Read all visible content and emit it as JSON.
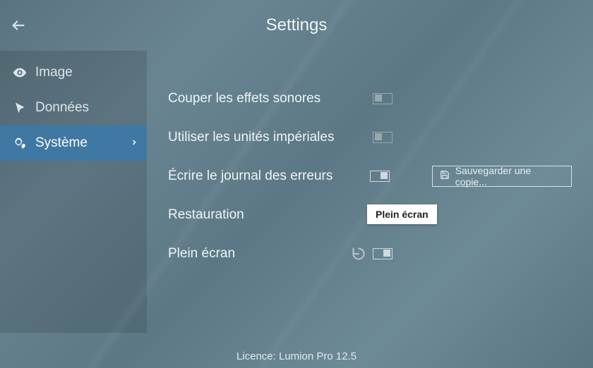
{
  "header": {
    "title": "Settings"
  },
  "sidebar": {
    "items": [
      {
        "label": "Image"
      },
      {
        "label": "Données"
      },
      {
        "label": "Système"
      }
    ]
  },
  "settings": {
    "mute_sound": {
      "label": "Couper les effets sonores",
      "on": false
    },
    "imperial": {
      "label": "Utiliser les unités impériales",
      "on": false
    },
    "error_log": {
      "label": "Écrire le journal des erreurs",
      "on": true,
      "save_label": "Sauvegarder une copie..."
    },
    "restore": {
      "label": "Restauration",
      "on": true
    },
    "fullscreen": {
      "label": "Plein écran",
      "on": true,
      "tooltip": "Plein écran"
    }
  },
  "footer": {
    "license_label": "Licence: ",
    "license_value": "Lumion Pro 12.5"
  }
}
